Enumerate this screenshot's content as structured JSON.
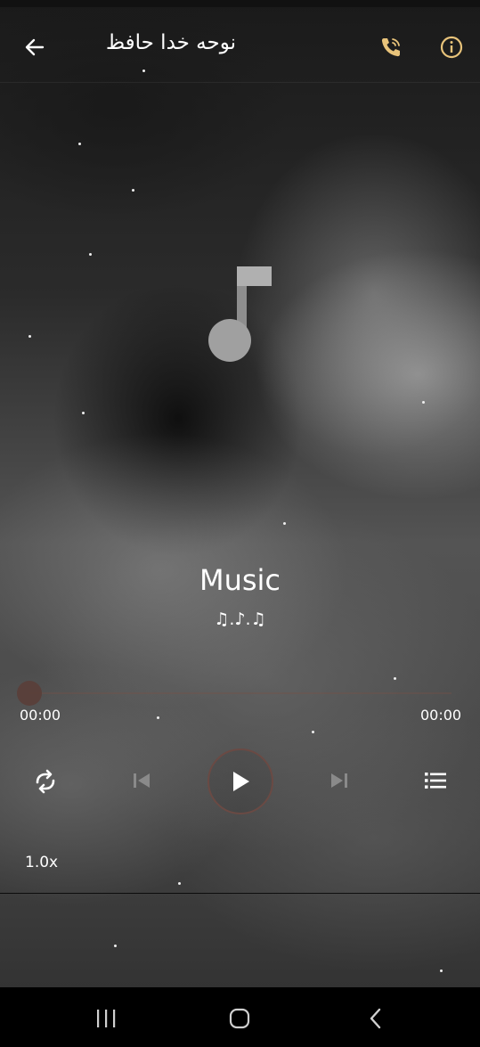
{
  "header": {
    "title": "نوحه خدا حافظ",
    "back_icon": "arrow-left-icon",
    "call_icon": "phone-call-icon",
    "info_icon": "info-circle-icon"
  },
  "player": {
    "track_title": "Music",
    "track_artist": "♫.♪.♫",
    "time_elapsed": "00:00",
    "time_total": "00:00",
    "progress": 0,
    "speed": "1.0x",
    "accent_color": "#6a4a44",
    "icons": {
      "album_art": "music-note-icon",
      "repeat": "repeat-icon",
      "previous": "skip-previous-icon",
      "play": "play-icon",
      "next": "skip-next-icon",
      "playlist": "playlist-icon"
    }
  },
  "navbar": {
    "recents_icon": "recents-icon",
    "home_icon": "home-icon",
    "back_icon": "back-chevron-icon"
  }
}
